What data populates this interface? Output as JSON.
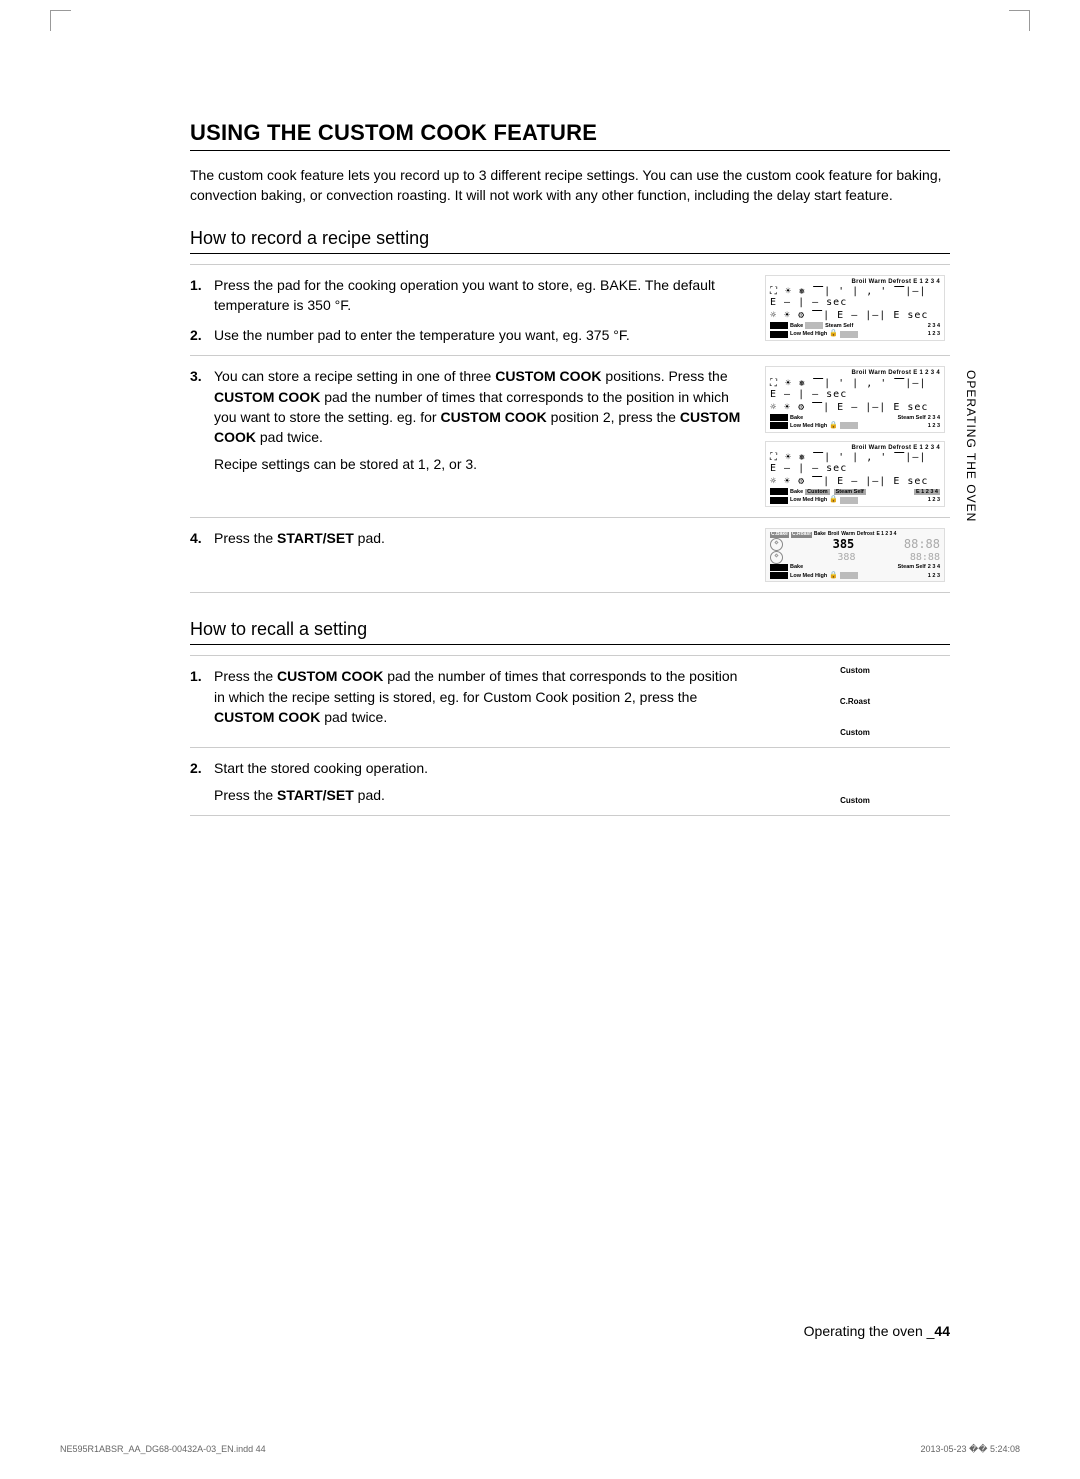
{
  "section_title": "USING THE CUSTOM COOK FEATURE",
  "intro": "The custom cook feature lets you record up to 3 different recipe settings. You can use the custom cook feature for baking, convection baking, or convection roasting. It will not work with any other function, including the delay start feature.",
  "record": {
    "heading": "How to record a recipe setting",
    "steps": [
      {
        "num": "1.",
        "text": "Press the pad for the cooking operation you want to store, eg. BAKE. The default temperature is 350 °F."
      },
      {
        "num": "2.",
        "text": "Use the number pad to enter the temperature you want, eg. 375 °F."
      },
      {
        "num": "3.",
        "text_parts": [
          "You can store a recipe setting in one of three ",
          "CUSTOM COOK",
          " positions. Press the ",
          "CUSTOM COOK",
          " pad the number of times that corresponds to the position in which you want to store the setting. eg. for ",
          "CUSTOM COOK",
          " position 2, press the ",
          "CUSTOM COOK",
          " pad twice."
        ],
        "extra": "Recipe settings can be stored at 1, 2, or 3."
      },
      {
        "num": "4.",
        "text_parts": [
          "Press the ",
          "START/SET",
          " pad."
        ]
      }
    ]
  },
  "recall": {
    "heading": "How to recall a setting",
    "steps": [
      {
        "num": "1.",
        "text_parts": [
          "Press the ",
          "CUSTOM COOK",
          " pad the number of times that corresponds to the position in which the recipe setting is stored, eg. for Custom Cook position 2, press the ",
          "CUSTOM COOK",
          " pad twice."
        ],
        "labels": [
          "Custom",
          "C.Roast",
          "Custom"
        ]
      },
      {
        "num": "2.",
        "lines": [
          "Start the stored cooking operation."
        ],
        "text_parts": [
          "Press the ",
          "START/SET",
          " pad."
        ],
        "labels": [
          "Custom"
        ]
      }
    ]
  },
  "display_text": {
    "top": "Broil  Warm  Defrost  E 1 2 3 4",
    "bottom1_a": "Bake",
    "bottom1_b": "Steam  Self",
    "bottom1_c": "2 3 4",
    "bottom2_a": "Low  Med  High",
    "bottom2_b": "1 2 3",
    "custom": "Custom",
    "mid_sym": "☼ ☀ ⚙   ⎺| E –   |–| E      sec",
    "mid_sym2": "⛶ ☀ ❅   ⎺| ' | ,  '  ⎺|–| E – |  – sec",
    "lock": "🔒",
    "active_heads": [
      "C.Bake",
      "C.Roast",
      "Bake",
      "Broil",
      "Warm",
      "Defrost",
      "E 1 2 3 4"
    ],
    "active_385": "385",
    "active_clock": "88:88",
    "active_clock_sub": "88:88"
  },
  "side_tab": "OPERATING THE OVEN",
  "footer_label": "Operating the oven _",
  "footer_page": "44",
  "print_file": "NE595R1ABSR_AA_DG68-00432A-03_EN.indd   44",
  "print_time": "2013-05-23   �� 5:24:08"
}
